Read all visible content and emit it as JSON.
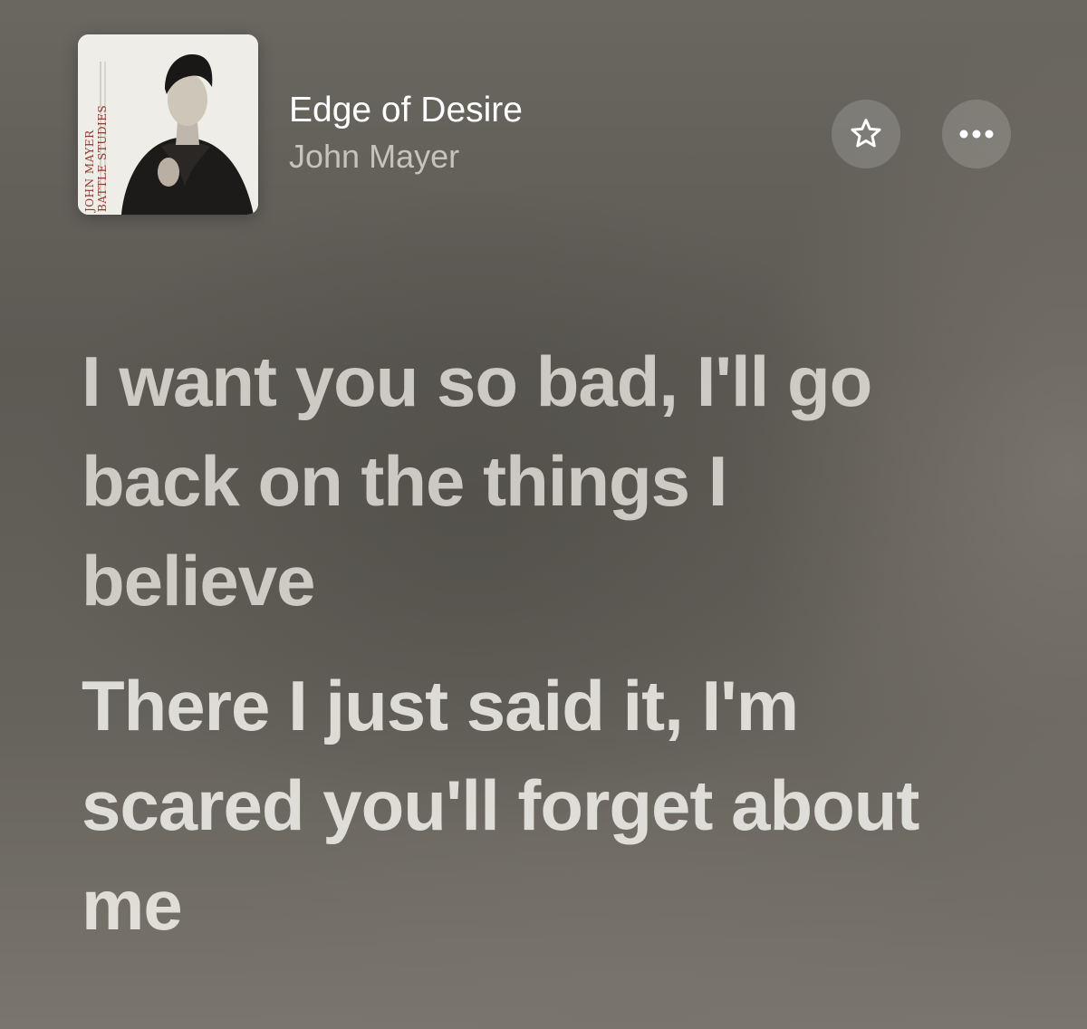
{
  "now_playing": {
    "album_art": {
      "icon": "album-cover",
      "cover_text_line1": "JOHN MAYER",
      "cover_text_line2": "BATTLE STUDIES"
    },
    "title": "Edge of Desire",
    "artist": "John Mayer",
    "favorite_icon": "star-outline-icon",
    "more_icon": "ellipsis-icon"
  },
  "lyrics": {
    "lines": [
      "I want you so bad, I'll go back on the things I believe",
      "There I just said it, I'm scared you'll forget about me"
    ]
  },
  "colors": {
    "background": "#605d57",
    "title": "#ffffff",
    "artist": "#bdb9b2",
    "lyrics": "#e6e3dc",
    "button_bg": "#7a7770"
  }
}
